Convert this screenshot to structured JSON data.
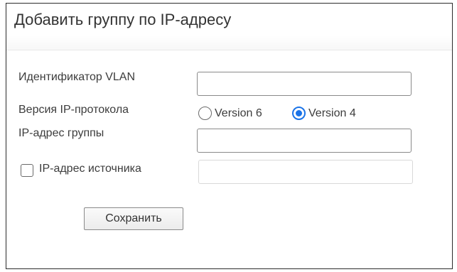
{
  "dialog": {
    "title": "Добавить группу по IP-адресу"
  },
  "form": {
    "vlan_label": "Идентификатор VLAN",
    "vlan_value": "",
    "ip_version_label": "Версия IP-протокола",
    "ip_version_options": [
      {
        "label": "Version 6",
        "selected": false
      },
      {
        "label": "Version 4",
        "selected": true
      }
    ],
    "group_ip_label": "IP-адрес группы",
    "group_ip_value": "",
    "source_ip_label": "IP-адрес источника",
    "source_ip_checked": false,
    "source_ip_value": "",
    "save_label": "Сохранить"
  }
}
